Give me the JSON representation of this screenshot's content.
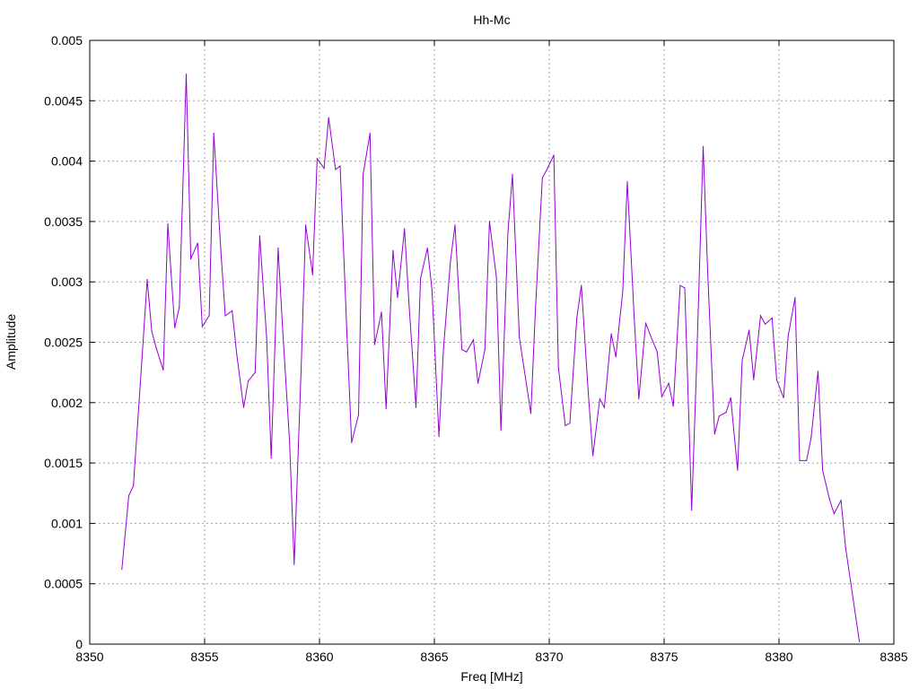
{
  "chart_data": {
    "type": "line",
    "title": "Hh-Mc",
    "xlabel": "Freq [MHz]",
    "ylabel": "Amplitude",
    "xlim": [
      8350,
      8385
    ],
    "ylim": [
      0,
      0.005
    ],
    "x_ticks": [
      "8350",
      "8355",
      "8360",
      "8365",
      "8370",
      "8375",
      "8380",
      "8385"
    ],
    "y_ticks": [
      "0",
      "0.0005",
      "0.001",
      "0.0015",
      "0.002",
      "0.0025",
      "0.003",
      "0.0035",
      "0.004",
      "0.0045",
      "0.005"
    ],
    "grid": true,
    "legend": "none",
    "series": [
      {
        "color": "#9400d3",
        "x": [
          8351.4,
          8351.7,
          8351.9,
          8352.2,
          8352.5,
          8352.7,
          8352.9,
          8353.2,
          8353.4,
          8353.7,
          8353.9,
          8354.2,
          8354.4,
          8354.7,
          8354.9,
          8355.2,
          8355.4,
          8355.7,
          8355.9,
          8356.2,
          8356.4,
          8356.7,
          8356.9,
          8357.2,
          8357.4,
          8357.7,
          8357.9,
          8358.2,
          8358.4,
          8358.7,
          8358.9,
          8359.2,
          8359.4,
          8359.7,
          8359.9,
          8360.2,
          8360.4,
          8360.7,
          8360.9,
          8361.2,
          8361.4,
          8361.7,
          8361.9,
          8362.2,
          8362.4,
          8362.7,
          8362.9,
          8363.2,
          8363.4,
          8363.7,
          8363.9,
          8364.2,
          8364.4,
          8364.7,
          8364.9,
          8365.2,
          8365.4,
          8365.7,
          8365.9,
          8366.2,
          8366.4,
          8366.7,
          8366.9,
          8367.2,
          8367.4,
          8367.7,
          8367.9,
          8368.2,
          8368.4,
          8368.7,
          8368.9,
          8369.2,
          8369.4,
          8369.7,
          8369.9,
          8370.2,
          8370.4,
          8370.7,
          8370.9,
          8371.2,
          8371.4,
          8371.7,
          8371.9,
          8372.2,
          8372.4,
          8372.7,
          8372.9,
          8373.2,
          8373.4,
          8373.7,
          8373.9,
          8374.2,
          8374.4,
          8374.7,
          8374.9,
          8375.2,
          8375.4,
          8375.7,
          8375.9,
          8376.2,
          8376.4,
          8376.7,
          8376.9,
          8377.2,
          8377.4,
          8377.7,
          8377.9,
          8378.2,
          8378.4,
          8378.7,
          8378.9,
          8379.2,
          8379.4,
          8379.7,
          8379.9,
          8380.2,
          8380.4,
          8380.7,
          8380.9,
          8381.2,
          8381.4,
          8381.7,
          8381.9,
          8382.2,
          8382.4,
          8382.7,
          8382.9,
          8383.2,
          8383.5
        ],
        "y": [
          0.00062,
          0.00123,
          0.00131,
          0.00215,
          0.00302,
          0.00259,
          0.00245,
          0.00227,
          0.00348,
          0.00262,
          0.00279,
          0.00472,
          0.00319,
          0.00332,
          0.00263,
          0.00272,
          0.00423,
          0.00328,
          0.00272,
          0.00276,
          0.0024,
          0.00196,
          0.00218,
          0.00225,
          0.00338,
          0.00254,
          0.00154,
          0.00328,
          0.0026,
          0.00167,
          0.00066,
          0.00227,
          0.00347,
          0.00306,
          0.00402,
          0.00394,
          0.00436,
          0.00393,
          0.00396,
          0.00255,
          0.00167,
          0.0019,
          0.00389,
          0.00423,
          0.00248,
          0.00275,
          0.00195,
          0.00326,
          0.00287,
          0.00344,
          0.00281,
          0.00196,
          0.00303,
          0.00328,
          0.00293,
          0.00172,
          0.00245,
          0.00317,
          0.00347,
          0.00244,
          0.00242,
          0.00252,
          0.00216,
          0.00244,
          0.0035,
          0.00304,
          0.00177,
          0.0034,
          0.00389,
          0.00254,
          0.00229,
          0.00191,
          0.00277,
          0.00386,
          0.00393,
          0.00405,
          0.00229,
          0.00181,
          0.00183,
          0.0027,
          0.00297,
          0.00208,
          0.00156,
          0.00203,
          0.00196,
          0.00257,
          0.00238,
          0.00292,
          0.00383,
          0.0027,
          0.00203,
          0.00266,
          0.00256,
          0.00242,
          0.00205,
          0.00216,
          0.00197,
          0.00297,
          0.00295,
          0.00111,
          0.00222,
          0.00412,
          0.00307,
          0.00174,
          0.00189,
          0.00192,
          0.00204,
          0.00144,
          0.00235,
          0.0026,
          0.00219,
          0.00272,
          0.00265,
          0.0027,
          0.00219,
          0.00204,
          0.00255,
          0.00287,
          0.00152,
          0.00152,
          0.00171,
          0.00226,
          0.00144,
          0.0012,
          0.00108,
          0.00119,
          0.0008,
          0.00041,
          2e-05
        ]
      }
    ]
  }
}
